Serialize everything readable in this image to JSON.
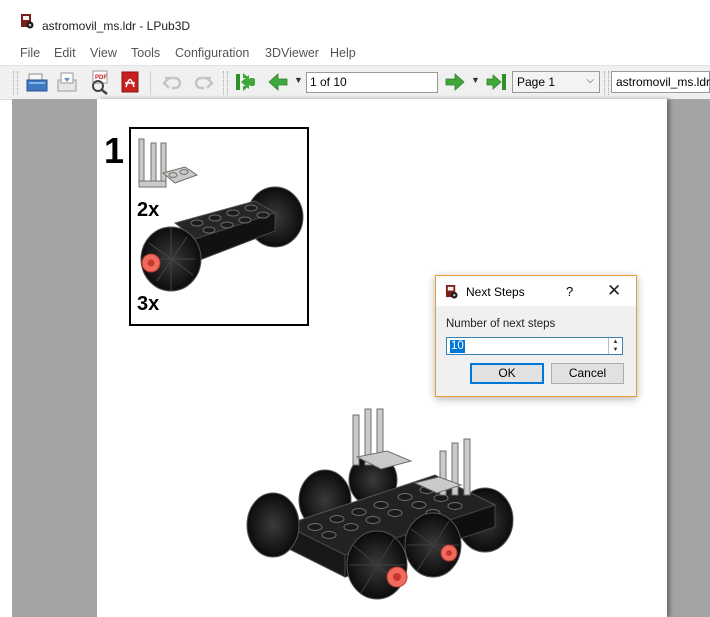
{
  "window": {
    "title": "astromovil_ms.ldr - LPub3D"
  },
  "menu": [
    "File",
    "Edit",
    "View",
    "Tools",
    "Configuration",
    "3DViewer",
    "Help"
  ],
  "toolbar": {
    "page_field": "1 of 10",
    "page_combo": "Page 1",
    "model_combo": "astromovil_ms.ldr"
  },
  "step": {
    "number": "1"
  },
  "pli": {
    "qty_1": "2x",
    "qty_2": "3x"
  },
  "dialog": {
    "title": "Next Steps",
    "help": "?",
    "close": "✕",
    "label": "Number of next steps",
    "value": "10",
    "ok": "OK",
    "cancel": "Cancel"
  },
  "icons": [
    "lpub3d-app-icon",
    "open-file-icon",
    "save-file-icon",
    "print-preview-icon",
    "export-pdf-icon",
    "undo-icon",
    "redo-icon",
    "first-page-icon",
    "previous-page-icon",
    "next-page-icon",
    "last-page-icon"
  ],
  "colors": {
    "accent": "#0078d7",
    "nav_green": "#3fa83a",
    "pdf_red": "#c8201e",
    "dialog_border": "#e39d3c",
    "workspace": "#a4a4a4"
  }
}
